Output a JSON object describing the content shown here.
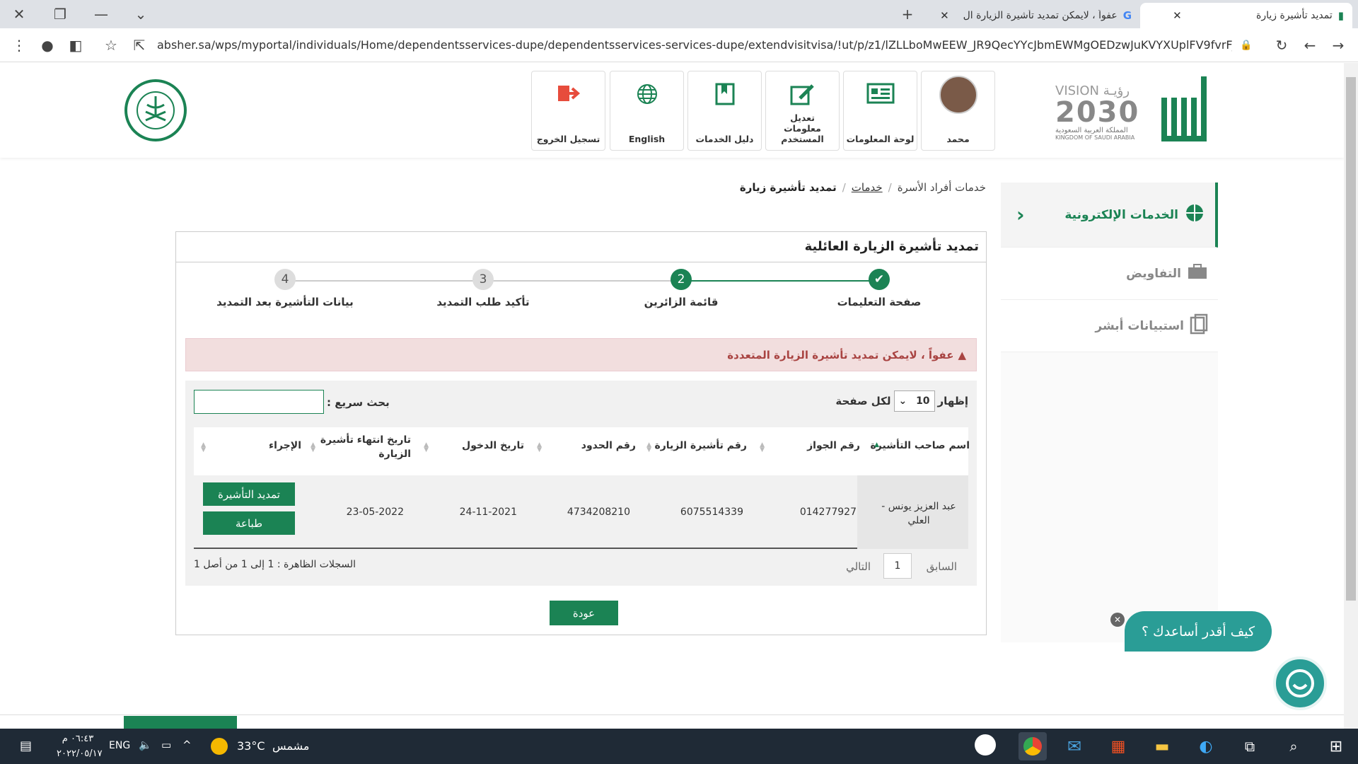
{
  "browser": {
    "tabs": [
      {
        "title": "تمديد تأشيرة زيارة",
        "active": true
      },
      {
        "title": "عفواً ، لايمكن تمديد تأشيرة الزيارة ال",
        "active": false
      }
    ],
    "url": "absher.sa/wps/myportal/individuals/Home/dependentsservices-dupe/dependentsservices-services-dupe/extendvisitvisa/!ut/p/z1/lZLLboMwEEW_JR9QecYYcJbmEWMgOEDzwJuKVYXUplFV9fvrFJQ..."
  },
  "header": {
    "nav": [
      {
        "label": "محمد",
        "icon": "avatar"
      },
      {
        "label": "لوحة المعلومات",
        "icon": "dashboard-icon"
      },
      {
        "label": "تعديل معلومات المستخدم",
        "icon": "edit-icon"
      },
      {
        "label": "دليل الخدمات",
        "icon": "book-icon"
      },
      {
        "label": "English",
        "icon": "globe-icon"
      },
      {
        "label": "تسجيل الخروج",
        "icon": "logout-icon"
      }
    ],
    "vision_text": "VISION رؤيـة",
    "vision_num": "2030",
    "vision_sub1": "المملكة العربية السعودية",
    "vision_sub2": "KINGDOM OF SAUDI ARABIA"
  },
  "breadcrumb": {
    "items": [
      "خدمات أفراد الأسرة",
      "خدمات",
      "تمديد تأشيرة زيارة"
    ],
    "sep": "/"
  },
  "sidebar": {
    "items": [
      {
        "label": "الخدمات الإلكترونية",
        "active": true
      },
      {
        "label": "التفاويض"
      },
      {
        "label": "استبيانات أبشر"
      }
    ]
  },
  "panel": {
    "title": "تمديد تأشيرة الزيارة العائلية",
    "steps": [
      {
        "num": "",
        "label": "صفحة التعليمات",
        "state": "done"
      },
      {
        "num": "2",
        "label": "قائمة الزائرين",
        "state": "current"
      },
      {
        "num": "3",
        "label": "تأكيد طلب التمديد",
        "state": "todo"
      },
      {
        "num": "4",
        "label": "بيانات التأشيرة بعد التمديد",
        "state": "todo"
      }
    ],
    "alert": "عفواً ، لايمكن تمديد تأشيرة الزيارة المتعددة",
    "show_label": "إظهار",
    "show_value": "10",
    "per_page": "لكل صفحة",
    "search_label": "بحث سريع :",
    "columns": [
      "اسم صاحب التأشيرة",
      "رقم الجواز",
      "رقم تأشيرة الزيارة",
      "رقم الحدود",
      "تاريخ الدخول",
      "تاريخ انتهاء تأشيرة الزيارة",
      "الإجراء"
    ],
    "rows": [
      {
        "name": "عبد العزيز يونس - العلي",
        "passport": "014277927",
        "visa": "6075514339",
        "border": "4734208210",
        "entry": "24-11-2021",
        "expiry": "23-05-2022"
      }
    ],
    "extend_btn": "تمديد التأشيرة",
    "print_btn": "طباعة",
    "prev": "السابق",
    "page": "1",
    "next": "التالي",
    "records": "السجلات الظاهرة : 1 إلى 1 من أصل 1",
    "back_btn": "عودة"
  },
  "chat": {
    "label": "كيف أقدر أساعدك ؟"
  },
  "taskbar": {
    "weather": "مشمس",
    "temp": "33°C",
    "lang": "ENG",
    "time": "٠٦:٤٣ م",
    "date": "٢٠٢٢/٠٥/١٧"
  },
  "colors": {
    "brand": "#1b8354",
    "alert_bg": "#f2dede",
    "alert_text": "#a94442"
  }
}
